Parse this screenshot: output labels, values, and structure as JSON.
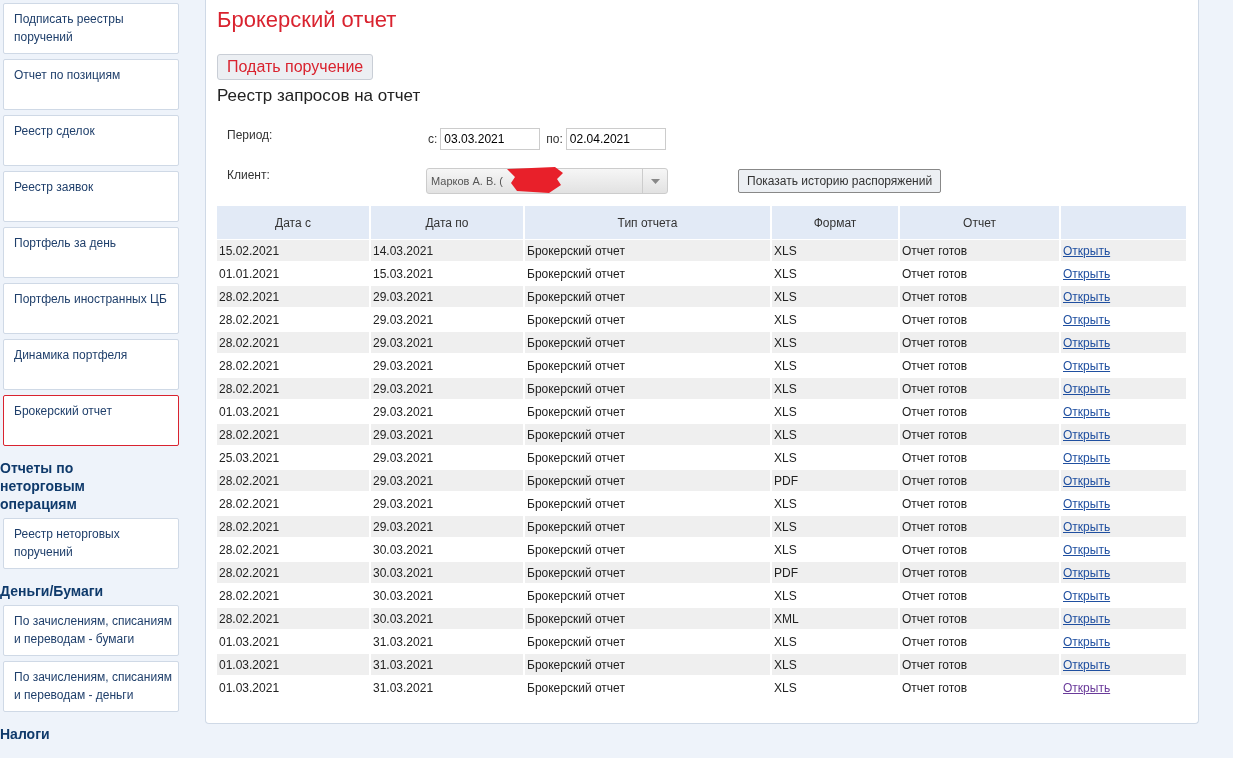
{
  "sidebar": {
    "groups": [
      {
        "items": [
          {
            "label": "Подписать реестры поручений",
            "selected": false
          },
          {
            "label": "Отчет по позициям",
            "selected": false
          },
          {
            "label": "Реестр сделок",
            "selected": false
          },
          {
            "label": "Реестр заявок",
            "selected": false
          },
          {
            "label": "Портфель за день",
            "selected": false
          },
          {
            "label": "Портфель иностранных ЦБ",
            "selected": false
          },
          {
            "label": "Динамика портфеля",
            "selected": false
          },
          {
            "label": "Брокерский отчет",
            "selected": true
          }
        ]
      },
      {
        "heading": "Отчеты по неторговым операциям",
        "items": [
          {
            "label": "Реестр неторговых поручений",
            "selected": false
          }
        ]
      },
      {
        "heading": "Деньги/Бумаги",
        "items": [
          {
            "label": "По зачислениям, списаниям и переводам - бумаги",
            "selected": false
          },
          {
            "label": "По зачислениям, списаниям и переводам - деньги",
            "selected": false
          }
        ]
      },
      {
        "heading": "Налоги"
      }
    ]
  },
  "page_title": "Брокерский отчет",
  "submit_button": "Подать поручение",
  "section_title": "Реестр запросов на отчет",
  "filters": {
    "period_label": "Период:",
    "from_label": "с:",
    "from_value": "03.03.2021",
    "to_label": "по:",
    "to_value": "02.04.2021",
    "client_label": "Клиент:",
    "client_value": "Марков А. В. (",
    "history_button": "Показать историю распоряжений"
  },
  "table": {
    "columns": [
      "Дата с",
      "Дата по",
      "Тип отчета",
      "Формат",
      "Отчет"
    ],
    "rows": [
      {
        "date_from": "15.02.2021",
        "date_to": "14.03.2021",
        "type": "Брокерский отчет",
        "format": "XLS",
        "status": "Отчет готов",
        "link": "Открыть",
        "visited": false
      },
      {
        "date_from": "01.01.2021",
        "date_to": "15.03.2021",
        "type": "Брокерский отчет",
        "format": "XLS",
        "status": "Отчет готов",
        "link": "Открыть",
        "visited": false
      },
      {
        "date_from": "28.02.2021",
        "date_to": "29.03.2021",
        "type": "Брокерский отчет",
        "format": "XLS",
        "status": "Отчет готов",
        "link": "Открыть",
        "visited": false
      },
      {
        "date_from": "28.02.2021",
        "date_to": "29.03.2021",
        "type": "Брокерский отчет",
        "format": "XLS",
        "status": "Отчет готов",
        "link": "Открыть",
        "visited": false
      },
      {
        "date_from": "28.02.2021",
        "date_to": "29.03.2021",
        "type": "Брокерский отчет",
        "format": "XLS",
        "status": "Отчет готов",
        "link": "Открыть",
        "visited": false
      },
      {
        "date_from": "28.02.2021",
        "date_to": "29.03.2021",
        "type": "Брокерский отчет",
        "format": "XLS",
        "status": "Отчет готов",
        "link": "Открыть",
        "visited": false
      },
      {
        "date_from": "28.02.2021",
        "date_to": "29.03.2021",
        "type": "Брокерский отчет",
        "format": "XLS",
        "status": "Отчет готов",
        "link": "Открыть",
        "visited": false
      },
      {
        "date_from": "01.03.2021",
        "date_to": "29.03.2021",
        "type": "Брокерский отчет",
        "format": "XLS",
        "status": "Отчет готов",
        "link": "Открыть",
        "visited": false
      },
      {
        "date_from": "28.02.2021",
        "date_to": "29.03.2021",
        "type": "Брокерский отчет",
        "format": "XLS",
        "status": "Отчет готов",
        "link": "Открыть",
        "visited": false
      },
      {
        "date_from": "25.03.2021",
        "date_to": "29.03.2021",
        "type": "Брокерский отчет",
        "format": "XLS",
        "status": "Отчет готов",
        "link": "Открыть",
        "visited": false
      },
      {
        "date_from": "28.02.2021",
        "date_to": "29.03.2021",
        "type": "Брокерский отчет",
        "format": "PDF",
        "status": "Отчет готов",
        "link": "Открыть",
        "visited": false
      },
      {
        "date_from": "28.02.2021",
        "date_to": "29.03.2021",
        "type": "Брокерский отчет",
        "format": "XLS",
        "status": "Отчет готов",
        "link": "Открыть",
        "visited": false
      },
      {
        "date_from": "28.02.2021",
        "date_to": "29.03.2021",
        "type": "Брокерский отчет",
        "format": "XLS",
        "status": "Отчет готов",
        "link": "Открыть",
        "visited": false
      },
      {
        "date_from": "28.02.2021",
        "date_to": "30.03.2021",
        "type": "Брокерский отчет",
        "format": "XLS",
        "status": "Отчет готов",
        "link": "Открыть",
        "visited": false
      },
      {
        "date_from": "28.02.2021",
        "date_to": "30.03.2021",
        "type": "Брокерский отчет",
        "format": "PDF",
        "status": "Отчет готов",
        "link": "Открыть",
        "visited": false
      },
      {
        "date_from": "28.02.2021",
        "date_to": "30.03.2021",
        "type": "Брокерский отчет",
        "format": "XLS",
        "status": "Отчет готов",
        "link": "Открыть",
        "visited": false
      },
      {
        "date_from": "28.02.2021",
        "date_to": "30.03.2021",
        "type": "Брокерский отчет",
        "format": "XML",
        "status": "Отчет готов",
        "link": "Открыть",
        "visited": false
      },
      {
        "date_from": "01.03.2021",
        "date_to": "31.03.2021",
        "type": "Брокерский отчет",
        "format": "XLS",
        "status": "Отчет готов",
        "link": "Открыть",
        "visited": false
      },
      {
        "date_from": "01.03.2021",
        "date_to": "31.03.2021",
        "type": "Брокерский отчет",
        "format": "XLS",
        "status": "Отчет готов",
        "link": "Открыть",
        "visited": false
      },
      {
        "date_from": "01.03.2021",
        "date_to": "31.03.2021",
        "type": "Брокерский отчет",
        "format": "XLS",
        "status": "Отчет готов",
        "link": "Открыть",
        "visited": true
      }
    ]
  }
}
